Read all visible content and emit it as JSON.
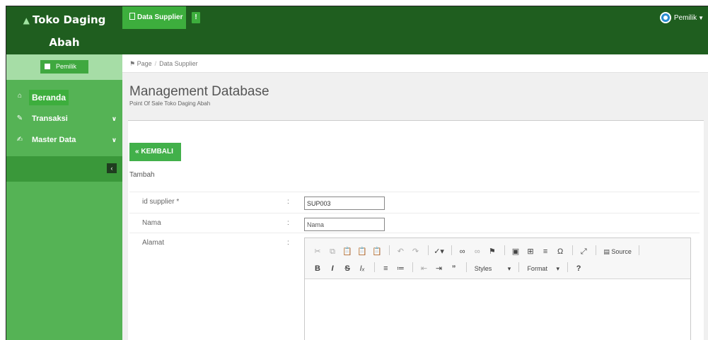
{
  "brand": {
    "line1": "Toko Daging",
    "line2": "Abah"
  },
  "topnav": {
    "tab_label": "Data Supplier",
    "alert_label": "!"
  },
  "user": {
    "name": "Pemilik"
  },
  "sidebar": {
    "user_chip": "Pemilik",
    "items": [
      {
        "label": "Beranda",
        "icon": "home-icon"
      },
      {
        "label": "Transaksi",
        "icon": "pencil-icon"
      },
      {
        "label": "Master Data",
        "icon": "edit-icon"
      }
    ]
  },
  "breadcrumb": {
    "home": "Page",
    "current": "Data Supplier"
  },
  "page": {
    "title": "Management Database",
    "subtitle": "Point Of Sale Toko Daging Abah"
  },
  "form": {
    "back_label": "KEMBALI",
    "section_label": "Tambah",
    "fields": [
      {
        "label": "id supplier *",
        "value": "SUP003",
        "placeholder": ""
      },
      {
        "label": "Nama",
        "value": "",
        "placeholder": "Nama"
      },
      {
        "label": "Alamat"
      }
    ],
    "colon": ":"
  },
  "editor": {
    "source_label": "Source",
    "styles_label": "Styles",
    "format_label": "Format"
  },
  "colors": {
    "topbar": "#1f5e1f",
    "sidebar": "#55b355",
    "accent": "#3dae3d",
    "button": "#42b04a"
  }
}
